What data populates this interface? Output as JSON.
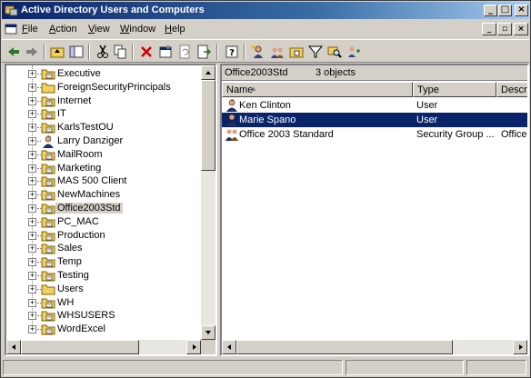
{
  "window": {
    "title": "Active Directory Users and Computers"
  },
  "menu": {
    "items": [
      {
        "label": "File",
        "accel": "F",
        "rest": "ile"
      },
      {
        "label": "Action",
        "accel": "A",
        "rest": "ction"
      },
      {
        "label": "View",
        "accel": "V",
        "rest": "iew"
      },
      {
        "label": "Window",
        "accel": "W",
        "rest": "indow"
      },
      {
        "label": "Help",
        "accel": "H",
        "rest": "elp"
      }
    ]
  },
  "toolbar": {
    "icons": [
      "back-icon",
      "forward-icon",
      "up-folder-icon",
      "show-tree-icon",
      "cut-icon",
      "copy-icon",
      "delete-icon",
      "properties-icon",
      "refresh-icon",
      "export-list-icon",
      "help-icon",
      "new-user-icon",
      "new-group-icon",
      "new-ou-icon",
      "filter-icon",
      "find-icon",
      "add-to-group-icon"
    ]
  },
  "tree": {
    "items": [
      {
        "label": "Executive",
        "icon": "ou-folder-icon",
        "expandable": true
      },
      {
        "label": "ForeignSecurityPrincipals",
        "icon": "folder-icon",
        "expandable": true
      },
      {
        "label": "Internet",
        "icon": "ou-folder-icon",
        "expandable": true
      },
      {
        "label": "IT",
        "icon": "ou-folder-icon",
        "expandable": true
      },
      {
        "label": "KarlsTestOU",
        "icon": "ou-folder-icon",
        "expandable": true
      },
      {
        "label": "Larry Danziger",
        "icon": "user-icon",
        "expandable": true
      },
      {
        "label": "MailRoom",
        "icon": "ou-folder-icon",
        "expandable": true
      },
      {
        "label": "Marketing",
        "icon": "ou-folder-icon",
        "expandable": true
      },
      {
        "label": "MAS 500 Client",
        "icon": "ou-folder-icon",
        "expandable": true
      },
      {
        "label": "NewMachines",
        "icon": "ou-folder-icon",
        "expandable": true
      },
      {
        "label": "Office2003Std",
        "icon": "ou-folder-icon",
        "expandable": true,
        "selected": true
      },
      {
        "label": "PC_MAC",
        "icon": "ou-folder-icon",
        "expandable": true
      },
      {
        "label": "Production",
        "icon": "ou-folder-icon",
        "expandable": true
      },
      {
        "label": "Sales",
        "icon": "ou-folder-icon",
        "expandable": true
      },
      {
        "label": "Temp",
        "icon": "ou-folder-icon",
        "expandable": true
      },
      {
        "label": "Testing",
        "icon": "ou-folder-icon",
        "expandable": true
      },
      {
        "label": "Users",
        "icon": "folder-icon",
        "expandable": true
      },
      {
        "label": "WH",
        "icon": "ou-folder-icon",
        "expandable": true
      },
      {
        "label": "WHSUSERS",
        "icon": "ou-folder-icon",
        "expandable": true
      },
      {
        "label": "WordExcel",
        "icon": "ou-folder-icon",
        "expandable": true
      }
    ]
  },
  "details": {
    "container_name": "Office2003Std",
    "object_count": "3 objects",
    "columns": [
      {
        "label": "Name",
        "sort": "▲"
      },
      {
        "label": "Type"
      },
      {
        "label": "Descrip"
      }
    ],
    "rows": [
      {
        "name": "Ken Clinton",
        "type": "User",
        "description": "",
        "icon": "user-icon"
      },
      {
        "name": "Marie Spano",
        "type": "User",
        "description": "",
        "icon": "user-icon",
        "selected": true
      },
      {
        "name": "Office 2003 Standard",
        "type": "Security Group ...",
        "description": "Office",
        "icon": "group-icon"
      }
    ]
  },
  "colors": {
    "title_bar": "#0a246a",
    "selection": "#0a246a",
    "chrome": "#d4d0c8"
  }
}
